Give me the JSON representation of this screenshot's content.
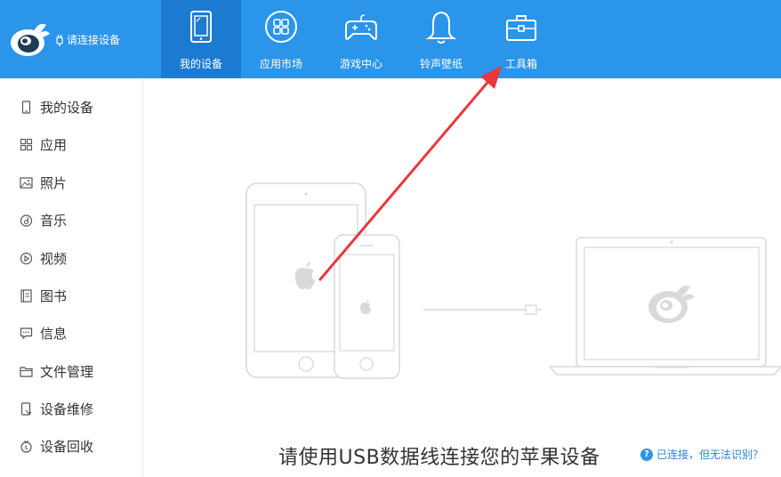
{
  "header": {
    "connect_status": "请连接设备",
    "tabs": [
      {
        "label": "我的设备",
        "icon": "tablet-icon",
        "active": true
      },
      {
        "label": "应用市场",
        "icon": "app-grid-icon",
        "active": false
      },
      {
        "label": "游戏中心",
        "icon": "gamepad-icon",
        "active": false
      },
      {
        "label": "铃声壁纸",
        "icon": "bell-icon",
        "active": false
      },
      {
        "label": "工具箱",
        "icon": "toolbox-icon",
        "active": false
      }
    ]
  },
  "sidebar": {
    "items": [
      {
        "label": "我的设备",
        "icon": "device-icon"
      },
      {
        "label": "应用",
        "icon": "apps-icon"
      },
      {
        "label": "照片",
        "icon": "photo-icon"
      },
      {
        "label": "音乐",
        "icon": "music-icon"
      },
      {
        "label": "视频",
        "icon": "video-icon"
      },
      {
        "label": "图书",
        "icon": "book-icon"
      },
      {
        "label": "信息",
        "icon": "message-icon"
      },
      {
        "label": "文件管理",
        "icon": "folder-icon"
      },
      {
        "label": "设备维修",
        "icon": "repair-icon"
      },
      {
        "label": "设备回收",
        "icon": "recycle-icon"
      }
    ]
  },
  "main": {
    "prompt": "请使用USB数据线连接您的苹果设备",
    "help_link": "已连接，但无法识别？",
    "help_icon_glyph": "?"
  },
  "colors": {
    "header_bg": "#2b95e9",
    "active_tab_bg": "#1c7bd0",
    "annotation_arrow": "#e8383d",
    "illustration_stroke": "#d9d9d9"
  }
}
